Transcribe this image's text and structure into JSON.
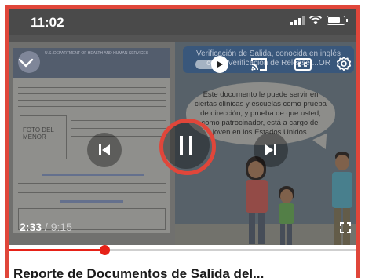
{
  "status_bar": {
    "time": "11:02",
    "icons": [
      "signal-icon",
      "wifi-icon",
      "battery-icon"
    ]
  },
  "video": {
    "illustration_header": "Verificación de Salida, conocida en inglés como Verificación de Release ...OR",
    "bubble_text": "Este documento le puede servir en ciertas clínicas y escuelas como prueba de dirección, y prueba de que usted, como patrocinador, está a cargo del joven en los Estados Unidos.",
    "document_heading": "U.S. DEPARTMENT OF HEALTH AND HUMAN SERVICES",
    "document_photo_label": "FOTO DEL MENOR"
  },
  "controls": {
    "collapse": "chevron-down-icon",
    "autoplay": "autoplay-toggle",
    "cast": "cast-icon",
    "captions": "closed-captions-icon",
    "settings": "gear-icon",
    "previous": "skip-previous-icon",
    "play_pause": "pause-icon",
    "next": "skip-next-icon",
    "fullscreen": "fullscreen-icon"
  },
  "playback": {
    "current_time": "2:33",
    "separator": " / ",
    "total_time": "9:15",
    "progress_fraction": 0.2757
  },
  "below_video": {
    "title_peek": "Reporte de Documentos de Salida del..."
  },
  "colors": {
    "highlight_ring": "#e0463a",
    "progress_red": "#e62117"
  }
}
